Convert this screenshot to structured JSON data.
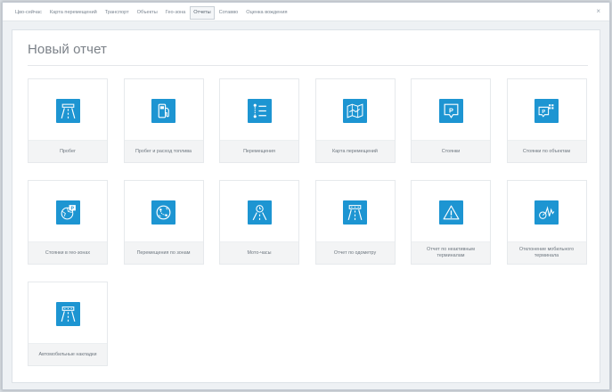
{
  "nav": {
    "items": [
      {
        "label": "Цво-сейчас",
        "active": false
      },
      {
        "label": "Карта перемещений",
        "active": false
      },
      {
        "label": "Транспорт",
        "active": false
      },
      {
        "label": "Объекты",
        "active": false
      },
      {
        "label": "Гео-зона",
        "active": false
      },
      {
        "label": "Отчеты",
        "active": true
      },
      {
        "label": "Сотавво",
        "active": false
      },
      {
        "label": "Оценка вождения",
        "active": false
      }
    ],
    "close_symbol": "×"
  },
  "page": {
    "title": "Новый отчет"
  },
  "colors": {
    "accent": "#1d95d2",
    "caption_bg": "#f3f4f5"
  },
  "tiles": [
    {
      "label": "Пробег",
      "icon": "road-icon"
    },
    {
      "label": "Пробег и расход топлива",
      "icon": "fuel-pump-icon"
    },
    {
      "label": "Перемещения",
      "icon": "route-list-icon"
    },
    {
      "label": "Карта перемещений",
      "icon": "map-icon"
    },
    {
      "label": "Стоянки",
      "icon": "parking-icon"
    },
    {
      "label": "Стоянки по объектам",
      "icon": "parking-objects-icon"
    },
    {
      "label": "Стоянки в гео-зонах",
      "icon": "parking-geozone-icon"
    },
    {
      "label": "Перемещения по зонам",
      "icon": "zone-movement-icon"
    },
    {
      "label": "Мото-часы",
      "icon": "engine-hours-icon"
    },
    {
      "label": "Отчет по одометру",
      "icon": "odometer-road-icon"
    },
    {
      "label": "Отчет по неактивным терминалам",
      "icon": "warning-icon"
    },
    {
      "label": "Отклонение мобильного терминала",
      "icon": "signal-deviation-icon"
    },
    {
      "label": "Автомобильные накладки",
      "icon": "waybill-road-icon"
    }
  ]
}
